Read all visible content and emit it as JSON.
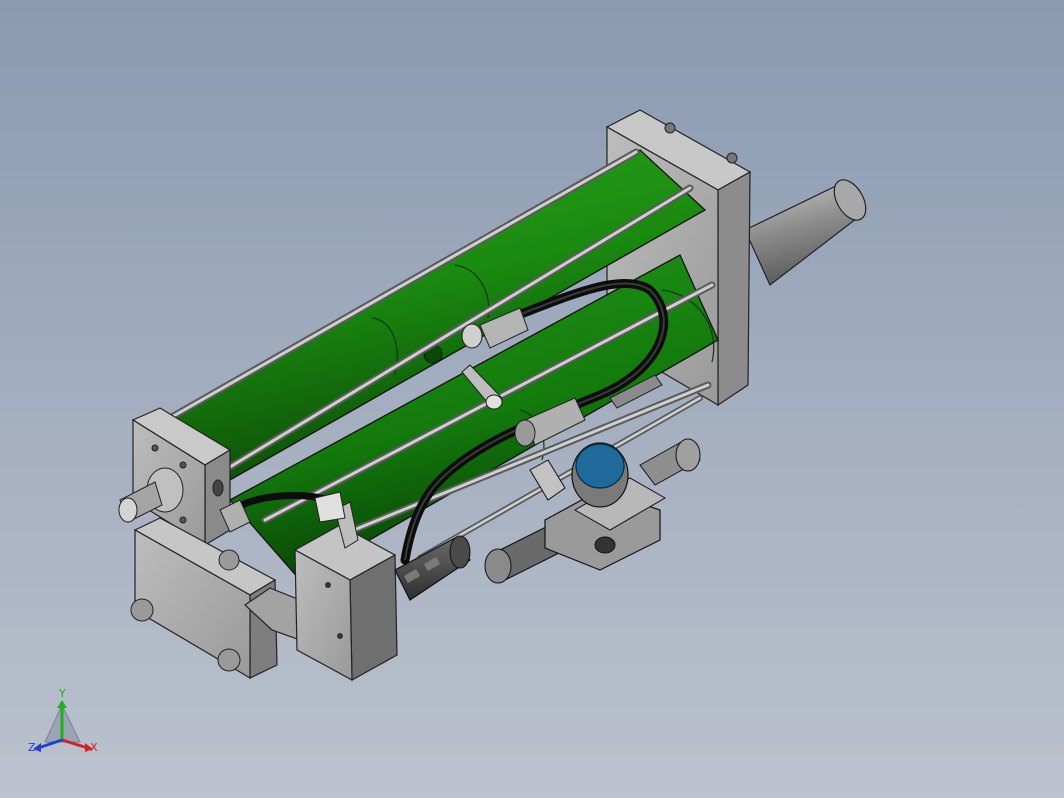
{
  "viewport": {
    "background_top": "#8a9ab1",
    "background_bottom": "#bcc2ce"
  },
  "model": {
    "cylinder_color": "#1f8f12",
    "metal_color": "#9a9a9a",
    "hose_color": "#151515",
    "gauge_color": "#1e6a9a"
  },
  "triad": {
    "x_label": "X",
    "y_label": "Y",
    "z_label": "Z",
    "x_color": "#d42020",
    "y_color": "#20b020",
    "z_color": "#2040d0"
  }
}
